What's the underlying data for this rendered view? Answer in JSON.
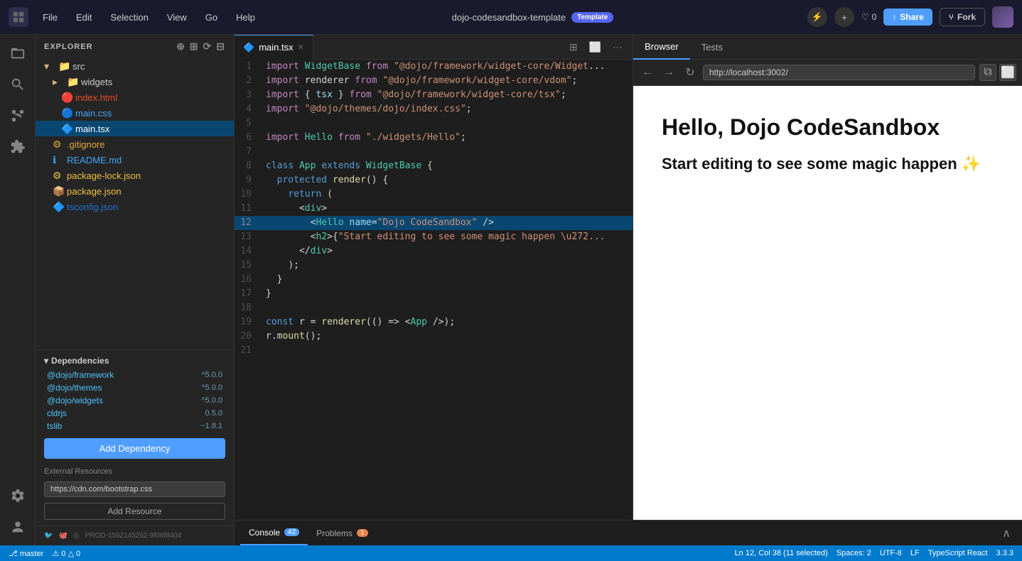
{
  "topbar": {
    "logo_label": "⊞",
    "menu": [
      "File",
      "Edit",
      "Selection",
      "View",
      "Go",
      "Help"
    ],
    "title": "dojo-codesandbox-template",
    "template_badge": "Template",
    "like_count": "0",
    "share_label": "Share",
    "fork_label": "Fork"
  },
  "sidebar": {
    "header": "Explorer",
    "src_folder": "src",
    "widgets_folder": "widgets",
    "files": [
      {
        "name": "index.html",
        "type": "html",
        "indent": 2
      },
      {
        "name": "main.css",
        "type": "css",
        "indent": 2
      },
      {
        "name": "main.tsx",
        "type": "tsx",
        "indent": 2,
        "active": true
      }
    ],
    "root_files": [
      {
        "name": ".gitignore",
        "type": "git"
      },
      {
        "name": "README.md",
        "type": "md"
      },
      {
        "name": "package-lock.json",
        "type": "json"
      },
      {
        "name": "package.json",
        "type": "json"
      },
      {
        "name": "tsconfig.json",
        "type": "tsx"
      }
    ],
    "dependencies_header": "Dependencies",
    "dependencies": [
      {
        "name": "@dojo/framework",
        "version": "^5.0.0"
      },
      {
        "name": "@dojo/themes",
        "version": "^5.0.0"
      },
      {
        "name": "@dojo/widgets",
        "version": "^5.0.0"
      },
      {
        "name": "cldrjs",
        "version": "0.5.0"
      },
      {
        "name": "tslib",
        "version": "~1.8.1"
      }
    ],
    "add_dependency_label": "Add Dependency",
    "external_resources_label": "External Resources",
    "external_url": "https://cdn.com/bootstrap.css",
    "add_resource_label": "Add Resource",
    "footer": {
      "prod_id": "PROD-1562145262-9f06f8404"
    }
  },
  "editor": {
    "tab_filename": "main.tsx",
    "lines": [
      {
        "num": 1,
        "code": "import WidgetBase from \"@dojo/framework/widget-core/WidgetB..."
      },
      {
        "num": 2,
        "code": "import renderer from \"@dojo/framework/widget-core/vdom\"; "
      },
      {
        "num": 3,
        "code": "import { tsx } from \"@dojo/framework/widget-core/tsx\";"
      },
      {
        "num": 4,
        "code": "import \"@dojo/themes/dojo/index.css\";"
      },
      {
        "num": 5,
        "code": ""
      },
      {
        "num": 6,
        "code": "import Hello from \"./widgets/Hello\";"
      },
      {
        "num": 7,
        "code": ""
      },
      {
        "num": 8,
        "code": "class App extends WidgetBase {"
      },
      {
        "num": 9,
        "code": "  protected render() {"
      },
      {
        "num": 10,
        "code": "    return ("
      },
      {
        "num": 11,
        "code": "      <div>"
      },
      {
        "num": 12,
        "code": "        <Hello name=\"Dojo CodeSandbox\" />"
      },
      {
        "num": 13,
        "code": "        <h2>{\"Start editing to see some magic happen \\u272..."
      },
      {
        "num": 14,
        "code": "      </div>"
      },
      {
        "num": 15,
        "code": "    );"
      },
      {
        "num": 16,
        "code": "  }"
      },
      {
        "num": 17,
        "code": "}"
      },
      {
        "num": 18,
        "code": ""
      },
      {
        "num": 19,
        "code": "const r = renderer(() => <App />);"
      },
      {
        "num": 20,
        "code": "r.mount();"
      },
      {
        "num": 21,
        "code": ""
      }
    ]
  },
  "browser": {
    "tab_browser": "Browser",
    "tab_tests": "Tests",
    "url": "http://localhost:3002/",
    "heading": "Hello, Dojo CodeSandbox",
    "subtext": "Start editing to see some magic happen ✨"
  },
  "bottom": {
    "console_label": "Console",
    "console_count": "42",
    "problems_label": "Problems",
    "problems_count": "1"
  },
  "statusbar": {
    "position": "Ln 12, Col 38 (11 selected)",
    "spaces": "Spaces: 2",
    "encoding": "UTF-8",
    "line_ending": "LF",
    "language": "TypeScript React",
    "version": "3.3.3"
  }
}
